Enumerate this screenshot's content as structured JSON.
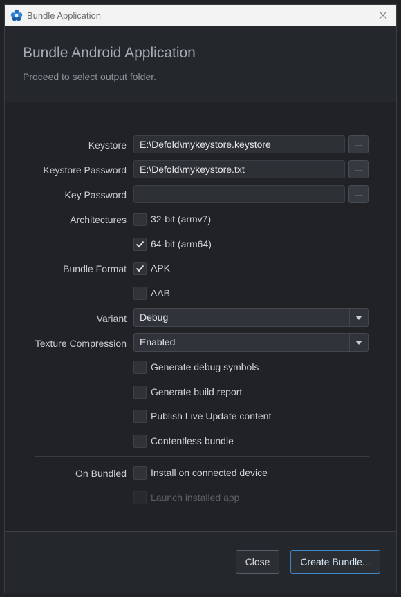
{
  "window": {
    "title": "Bundle Application",
    "close_icon": "close-icon"
  },
  "header": {
    "title": "Bundle Android Application",
    "subtitle": "Proceed to select output folder."
  },
  "form": {
    "keystore": {
      "label": "Keystore",
      "value": "E:\\Defold\\mykeystore.keystore",
      "browse": "..."
    },
    "keystore_password": {
      "label": "Keystore Password",
      "value": "E:\\Defold\\mykeystore.txt",
      "browse": "..."
    },
    "key_password": {
      "label": "Key Password",
      "value": "",
      "browse": "..."
    },
    "architectures": {
      "label": "Architectures",
      "options": [
        {
          "label": "32-bit (armv7)",
          "checked": false
        },
        {
          "label": "64-bit (arm64)",
          "checked": true
        }
      ]
    },
    "bundle_format": {
      "label": "Bundle Format",
      "options": [
        {
          "label": "APK",
          "checked": true
        },
        {
          "label": "AAB",
          "checked": false
        }
      ]
    },
    "variant": {
      "label": "Variant",
      "value": "Debug"
    },
    "texture_compression": {
      "label": "Texture Compression",
      "value": "Enabled"
    },
    "options": [
      {
        "label": "Generate debug symbols",
        "checked": false
      },
      {
        "label": "Generate build report",
        "checked": false
      },
      {
        "label": "Publish Live Update content",
        "checked": false
      },
      {
        "label": "Contentless bundle",
        "checked": false
      }
    ],
    "on_bundled": {
      "label": "On Bundled",
      "options": [
        {
          "label": "Install on connected device",
          "checked": false,
          "enabled": true
        },
        {
          "label": "Launch installed app",
          "checked": false,
          "enabled": false
        }
      ]
    }
  },
  "footer": {
    "close_label": "Close",
    "create_label": "Create Bundle..."
  },
  "colors": {
    "accent": "#3f86c7",
    "background": "#202226",
    "titlebar": "#f3f3f3"
  }
}
